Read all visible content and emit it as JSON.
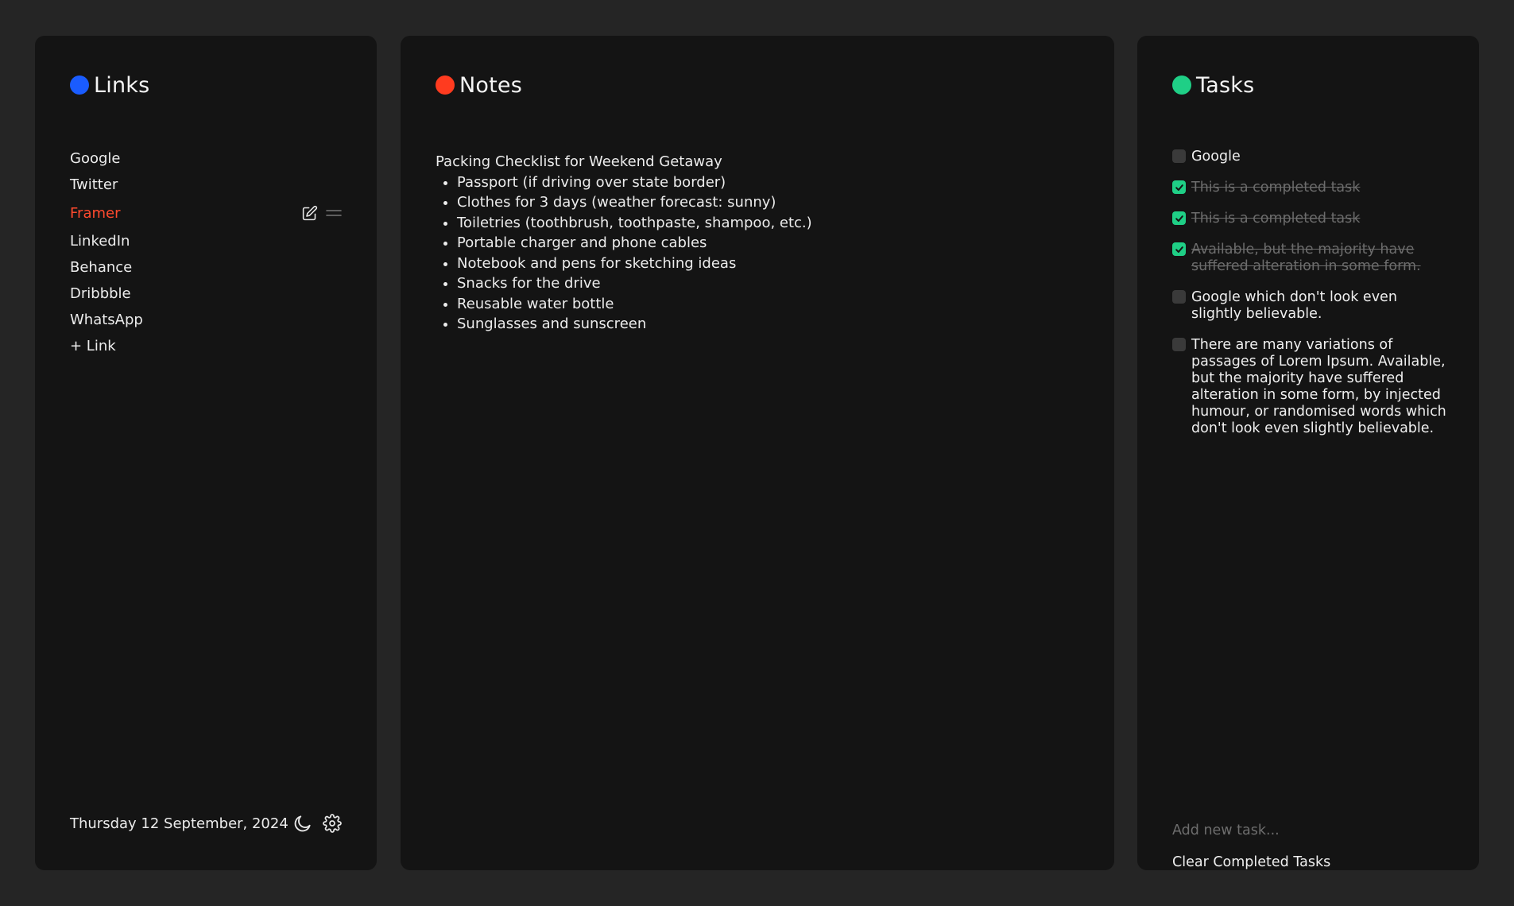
{
  "colors": {
    "links_accent": "#1a5cff",
    "notes_accent": "#ff3b1f",
    "tasks_accent": "#1fcf86",
    "active_link": "#ff4a2e"
  },
  "links": {
    "title": "Links",
    "items": [
      {
        "label": "Google",
        "active": false
      },
      {
        "label": "Twitter",
        "active": false
      },
      {
        "label": "Framer",
        "active": true
      },
      {
        "label": "LinkedIn",
        "active": false
      },
      {
        "label": "Behance",
        "active": false
      },
      {
        "label": "Dribbble",
        "active": false
      },
      {
        "label": "WhatsApp",
        "active": false
      }
    ],
    "add_label": "+ Link",
    "icons": {
      "edit": "edit-icon",
      "drag": "drag-handle-icon"
    }
  },
  "footer": {
    "date": "Thursday 12 September, 2024",
    "icons": {
      "theme": "moon-icon",
      "settings": "gear-icon"
    }
  },
  "notes": {
    "title": "Notes",
    "heading": "Packing Checklist for Weekend Getaway",
    "items": [
      "Passport (if driving over state border)",
      "Clothes for 3 days (weather forecast: sunny)",
      "Toiletries (toothbrush, toothpaste, shampoo, etc.)",
      "Portable charger and phone cables",
      "Notebook and pens for sketching ideas",
      "Snacks for the drive",
      "Reusable water bottle",
      "Sunglasses and sunscreen"
    ]
  },
  "tasks": {
    "title": "Tasks",
    "items": [
      {
        "text": "Google",
        "done": false
      },
      {
        "text": "This is a completed task",
        "done": true
      },
      {
        "text": "This is a completed task",
        "done": true
      },
      {
        "text": "Available, but the majority have suffered alteration in some form.",
        "done": true
      },
      {
        "text": "Google which don't look even slightly believable.",
        "done": false
      },
      {
        "text": "There are many variations of passages of Lorem Ipsum. Available, but the majority have suffered alteration in some form, by injected humour, or randomised words which don't look even slightly believable.",
        "done": false
      }
    ],
    "new_task_placeholder": "Add new task...",
    "clear_label": "Clear Completed Tasks"
  }
}
